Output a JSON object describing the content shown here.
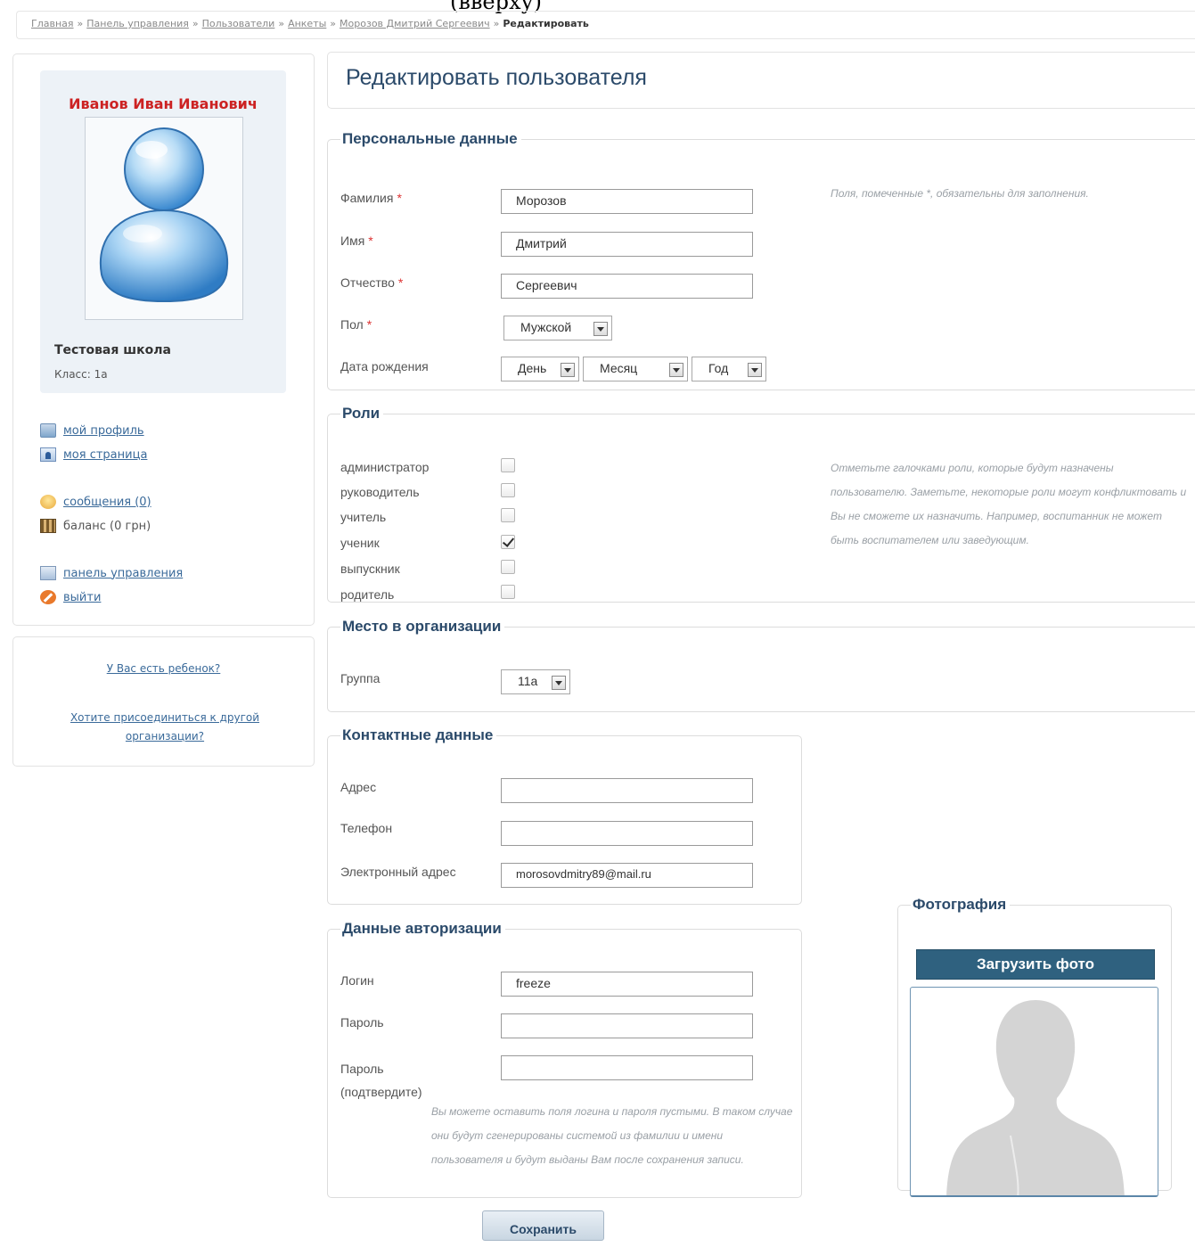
{
  "top_caption": "(вверху)",
  "breadcrumb": [
    "Главная",
    "Панель управления",
    "Пользователи",
    "Анкеты",
    "Морозов Дмитрий Сергеевич"
  ],
  "breadcrumb_sep": "»",
  "breadcrumb_current": "Редактировать",
  "profile": {
    "name": "Иванов Иван Иванович",
    "school": "Тестовая школа",
    "class_line": "Класс: 1а"
  },
  "nav": {
    "my_profile": "мой профиль",
    "my_page": "моя страница",
    "messages": "сообщения (0)",
    "balance": "баланс (0 грн)",
    "control_panel": "панель управления",
    "logout": "выйти"
  },
  "side_links": {
    "child": "У Вас есть ребенок?",
    "join": "Хотите присоединиться к другой организации?"
  },
  "page_title": "Редактировать пользователя",
  "personal": {
    "legend": "Персональные данные",
    "required_mark": "*",
    "hint": "Поля, помеченные *, обязательны для заполнения.",
    "lastname_label": "Фамилия",
    "lastname_value": "Морозов",
    "firstname_label": "Имя",
    "firstname_value": "Дмитрий",
    "patronymic_label": "Отчество",
    "patronymic_value": "Сергеевич",
    "gender_label": "Пол",
    "gender_value": "Мужской",
    "birth_label": "Дата рождения",
    "birth_day": "День",
    "birth_month": "Месяц",
    "birth_year": "Год"
  },
  "roles": {
    "legend": "Роли",
    "items": [
      {
        "label": "администратор",
        "checked": false
      },
      {
        "label": "руководитель",
        "checked": false
      },
      {
        "label": "учитель",
        "checked": false
      },
      {
        "label": "ученик",
        "checked": true
      },
      {
        "label": "выпускник",
        "checked": false
      },
      {
        "label": "родитель",
        "checked": false
      }
    ],
    "hint": "Отметьте галочками роли, которые будут назначены пользователю. Заметьте, некоторые роли могут конфликтовать и Вы не сможете их назначить. Например, воспитанник не может быть воспитателем или заведующим."
  },
  "org": {
    "legend": "Место в организации",
    "group_label": "Группа",
    "group_value": "11а"
  },
  "contacts": {
    "legend": "Контактные данные",
    "address_label": "Адрес",
    "address_value": "",
    "phone_label": "Телефон",
    "phone_value": "",
    "email_label": "Электронный адрес",
    "email_value": "morosovdmitry89@mail.ru"
  },
  "auth": {
    "legend": "Данные авторизации",
    "login_label": "Логин",
    "login_value": "freeze",
    "password_label": "Пароль",
    "password_confirm_label": "Пароль (подтвердите)",
    "hint": "Вы можете оставить поля логина и пароля пустыми. В таком случае они будут сгенерированы системой из фамилии и имени пользователя и будут выданы Вам после сохранения записи."
  },
  "photo": {
    "legend": "Фотография",
    "upload_label": "Загрузить фото"
  },
  "save_label": "Сохранить",
  "colors": {
    "accent": "#2b4a6a",
    "name_red": "#cc2222",
    "upload_bg": "#2f617f"
  }
}
